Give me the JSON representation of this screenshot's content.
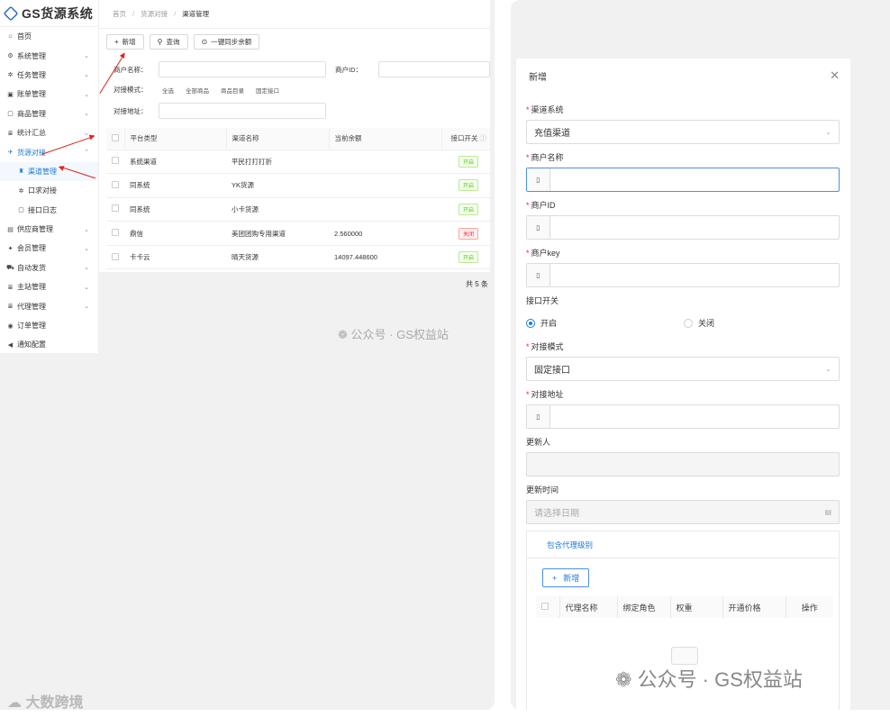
{
  "app": {
    "logo_text": "GS货源系统"
  },
  "breadcrumb": [
    "首页",
    "货源对接",
    "渠道管理"
  ],
  "sidebar": {
    "items": [
      {
        "icon": "home-icon",
        "glyph": "⌂",
        "label": "首页",
        "chev": ""
      },
      {
        "icon": "gears-icon",
        "glyph": "⚙",
        "label": "系统管理",
        "chev": "⌄"
      },
      {
        "icon": "tasks-icon",
        "glyph": "✲",
        "label": "任务管理",
        "chev": "⌄"
      },
      {
        "icon": "bill-icon",
        "glyph": "▣",
        "label": "账单管理",
        "chev": "⌄"
      },
      {
        "icon": "goods-icon",
        "glyph": "▢",
        "label": "商品管理",
        "chev": "⌄"
      },
      {
        "icon": "stats-icon",
        "glyph": "≣",
        "label": "统计汇总",
        "chev": "⌄"
      },
      {
        "icon": "source-icon",
        "glyph": "✈",
        "label": "货源对接",
        "chev": "⌃"
      },
      {
        "icon": "shield-icon",
        "glyph": "♜",
        "label": "渠道管理",
        "chev": ""
      },
      {
        "icon": "dock-icon",
        "glyph": "✲",
        "label": "口求对接",
        "chev": ""
      },
      {
        "icon": "log-icon",
        "glyph": "▢",
        "label": "接口日志",
        "chev": ""
      },
      {
        "icon": "supplier-icon",
        "glyph": "▤",
        "label": "供应商管理",
        "chev": "⌄"
      },
      {
        "icon": "member-icon",
        "glyph": "✦",
        "label": "会员管理",
        "chev": "⌄"
      },
      {
        "icon": "auto-icon",
        "glyph": "⛟",
        "label": "自动发货",
        "chev": "⌄"
      },
      {
        "icon": "station-icon",
        "glyph": "≣",
        "label": "主站管理",
        "chev": "⌄"
      },
      {
        "icon": "agent-icon",
        "glyph": "≣",
        "label": "代理管理",
        "chev": "⌄"
      },
      {
        "icon": "order-icon",
        "glyph": "◉",
        "label": "订单管理",
        "chev": ""
      },
      {
        "icon": "notice-icon",
        "glyph": "◀",
        "label": "通知配置",
        "chev": ""
      }
    ]
  },
  "toolbar": {
    "add": "新增",
    "query": "查询",
    "sync": "一键同步余额"
  },
  "filters": {
    "merchant_name": "商户名称：",
    "merchant_id": "商户ID：",
    "mode": "对接模式：",
    "modes": [
      "全选",
      "全部商品",
      "商品目录",
      "固定接口"
    ],
    "address": "对接地址："
  },
  "table": {
    "headers": [
      "平台类型",
      "渠道名称",
      "当前余额",
      "接口开关"
    ],
    "rows": [
      {
        "platform": "系统渠道",
        "name": "平民打打打折",
        "balance": "",
        "switch": "开启",
        "on": true
      },
      {
        "platform": "同系统",
        "name": "YK货源",
        "balance": "",
        "switch": "开启",
        "on": true
      },
      {
        "platform": "同系统",
        "name": "小卡货源",
        "balance": "",
        "switch": "开启",
        "on": true
      },
      {
        "platform": "鼎信",
        "name": "美团团购专用渠道",
        "balance": "2.560000",
        "switch": "关闭",
        "on": false
      },
      {
        "platform": "卡卡云",
        "name": "晴天货源",
        "balance": "14097.448600",
        "switch": "开启",
        "on": true
      }
    ],
    "total": "共 5 条"
  },
  "watermarks": {
    "left": "公众号 · GS权益站",
    "modal": "公众号 · GS权益站",
    "corner": "大数跨境"
  },
  "modal": {
    "title": "新增",
    "fields": {
      "channel_system": {
        "label": "渠道系统",
        "value": "充值渠道"
      },
      "merchant_name": {
        "label": "商户名称",
        "value": ""
      },
      "merchant_id": {
        "label": "商户ID",
        "value": ""
      },
      "merchant_key": {
        "label": "商户key",
        "value": ""
      },
      "switch": {
        "label": "接口开关",
        "on": "开启",
        "off": "关闭"
      },
      "mode": {
        "label": "对接模式",
        "value": "固定接口"
      },
      "address": {
        "label": "对接地址",
        "value": ""
      },
      "updater": {
        "label": "更新人",
        "value": ""
      },
      "update_time": {
        "label": "更新时间",
        "placeholder": "请选择日期"
      }
    },
    "tab": {
      "label": "包含代理级别",
      "add": "新增",
      "headers": [
        "代理名称",
        "绑定角色",
        "权重",
        "开通价格",
        "操作"
      ]
    }
  }
}
